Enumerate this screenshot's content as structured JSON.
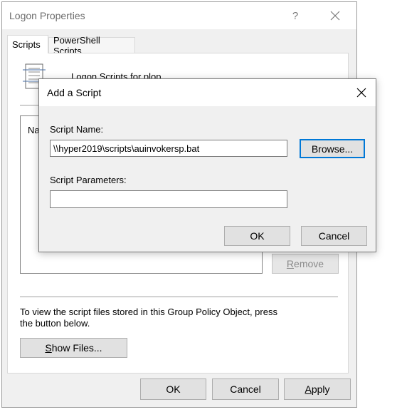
{
  "main_window": {
    "title": "Logon Properties",
    "help_glyph": "?",
    "tabs": [
      {
        "label": "Scripts",
        "active": true
      },
      {
        "label": "PowerShell Scripts",
        "active": false
      }
    ],
    "partial_heading": "Logon Scripts for plop",
    "list_header_partial": "Na",
    "remove_button": {
      "mnemonic": "R",
      "rest": "emove",
      "enabled": false
    },
    "info_text": "To view the script files stored in this Group Policy Object, press the button below.",
    "show_files_button": {
      "mnemonic": "S",
      "rest": "how Files..."
    },
    "buttons": {
      "ok": "OK",
      "cancel": "Cancel",
      "apply_mnemonic": "A",
      "apply_rest": "pply"
    }
  },
  "dialog": {
    "title": "Add a Script",
    "script_name_label": "Script Name:",
    "script_name_value": "\\\\hyper2019\\scripts\\auinvokersp.bat",
    "browse_button": "Browse...",
    "script_params_label": "Script Parameters:",
    "script_params_value": "",
    "ok_button": "OK",
    "cancel_button": "Cancel"
  },
  "colors": {
    "accent": "#0078d7",
    "window_bg": "#f0f0f0"
  }
}
